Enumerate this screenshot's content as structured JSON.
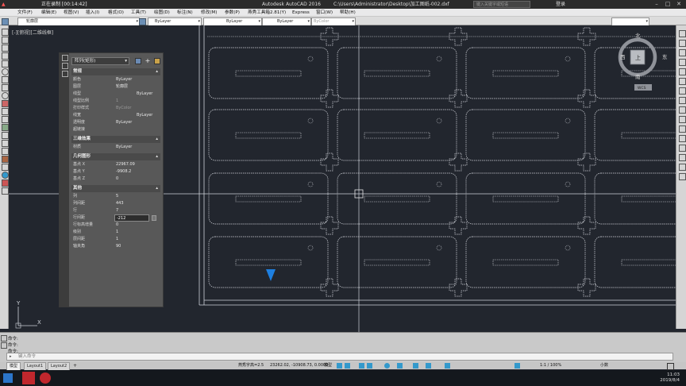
{
  "titlebar": {
    "status": "正在录制 [00:14:42]",
    "app_title": "Autodesk AutoCAD 2016",
    "file_path": "C:\\Users\\Administrator\\Desktop\\加工图纸-002.dxf",
    "search_placeholder": "键入关键字或短语",
    "login": "登录"
  },
  "menu": {
    "items": [
      "文件(F)",
      "编辑(E)",
      "视图(V)",
      "插入(I)",
      "格式(O)",
      "工具(T)",
      "绘图(D)",
      "标注(N)",
      "修改(M)",
      "参数(P)",
      "燕秀工具箱2.81(Y)",
      "Express",
      "窗口(W)",
      "帮助(H)"
    ]
  },
  "toolbar": {
    "layer": "轮廓层",
    "color": "ByLayer",
    "linetype": "ByLayer",
    "lineweight": "ByLayer",
    "plotstyle": "ByColor"
  },
  "viewport": {
    "label": "[-][俯视][二维线框]",
    "viewcube_top": "北",
    "viewcube_west": "西",
    "viewcube_east": "东",
    "viewcube_south": "南",
    "viewcube_face": "上",
    "wcs": "WCS",
    "ucs_x": "X",
    "ucs_y": "Y"
  },
  "palette": {
    "object_type": "阵列(矩形)",
    "sections": [
      {
        "title": "常规",
        "rows": [
          [
            "颜色",
            "ByLayer"
          ],
          [
            "图层",
            "轮廓层"
          ],
          [
            "线型",
            "ByLayer"
          ],
          [
            "线型比例",
            "1"
          ],
          [
            "打印样式",
            "ByColor"
          ],
          [
            "线宽",
            "ByLayer"
          ],
          [
            "透明度",
            "ByLayer"
          ],
          [
            "超链接",
            ""
          ]
        ]
      },
      {
        "title": "三维效果",
        "rows": [
          [
            "材质",
            "ByLayer"
          ]
        ]
      },
      {
        "title": "几何图形",
        "rows": [
          [
            "基点 X",
            "22967.09"
          ],
          [
            "基点 Y",
            "-9908.2"
          ],
          [
            "基点 Z",
            "0"
          ]
        ]
      },
      {
        "title": "其他",
        "rows": [
          [
            "列",
            "5"
          ],
          [
            "列间距",
            "443"
          ],
          [
            "行",
            "7"
          ],
          [
            "行间距",
            "-212"
          ],
          [
            "行标高增量",
            "0"
          ],
          [
            "级别",
            "1"
          ],
          [
            "层间距",
            "1"
          ],
          [
            "轴夹角",
            "90"
          ]
        ]
      }
    ]
  },
  "command": {
    "history": [
      "命令:",
      "命令:",
      "命令:"
    ],
    "placeholder": "键入命令"
  },
  "tabs": [
    "模型",
    "Layout1",
    "Layout2"
  ],
  "statusbar": {
    "scale_hint": "燕秀字高=2.5",
    "coords": "23262.02, -10908.73, 0.0000",
    "model": "模型",
    "annot_scale": "1:1 / 100%",
    "units": "小数"
  },
  "taskbar": {
    "time": "11:03",
    "date": "2019/8/4"
  }
}
